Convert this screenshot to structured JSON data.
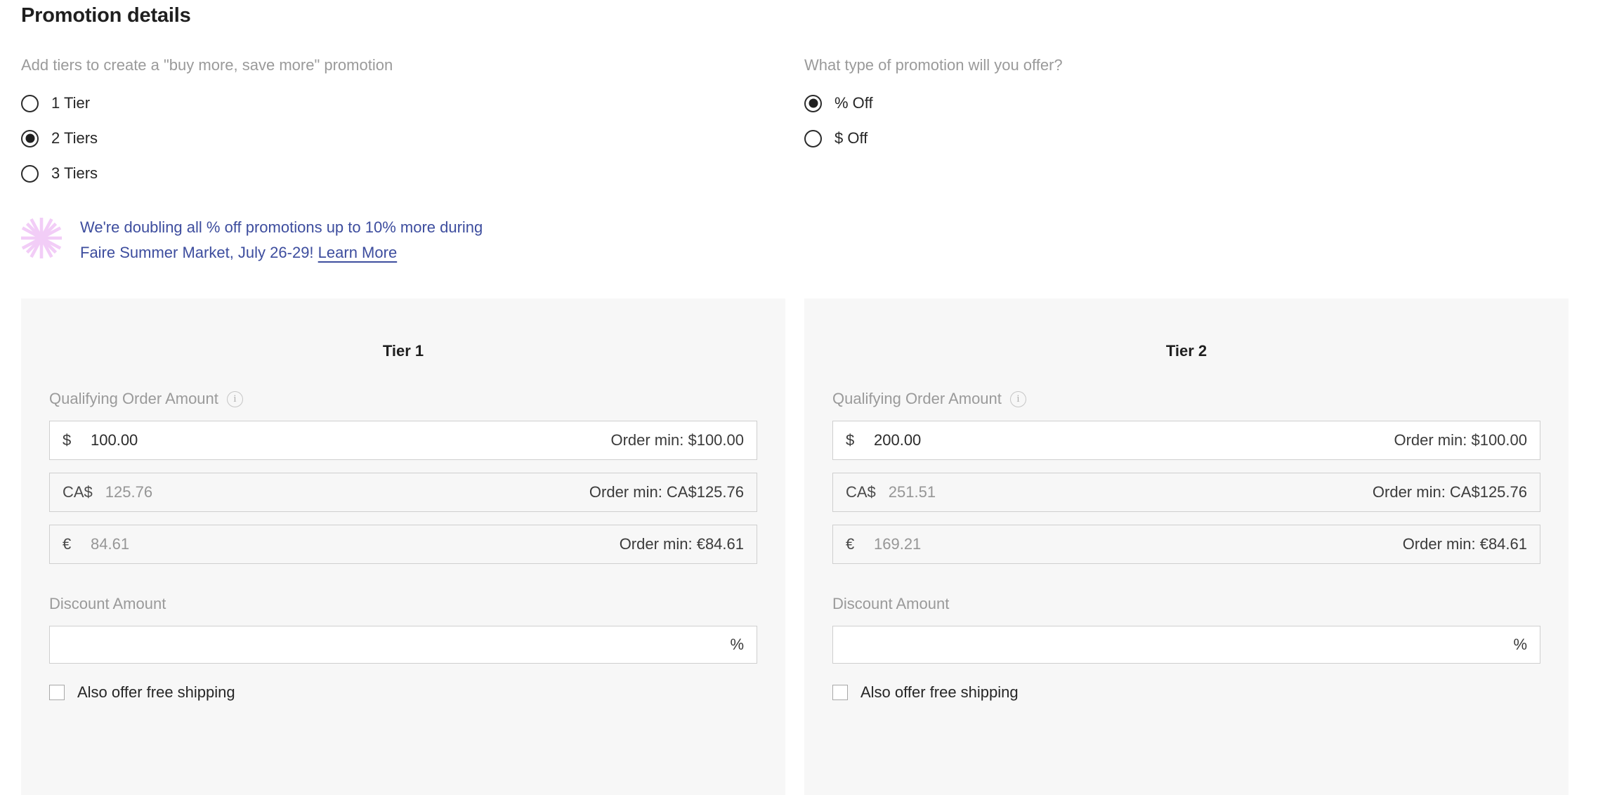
{
  "page_title": "Promotion details",
  "tier_count_group": {
    "prompt": "Add tiers to create a \"buy more, save more\" promotion",
    "selected": "2 Tiers",
    "options": [
      {
        "label": "1 Tier",
        "checked": false
      },
      {
        "label": "2 Tiers",
        "checked": true
      },
      {
        "label": "3 Tiers",
        "checked": false
      }
    ]
  },
  "promo_type_group": {
    "prompt": "What type of promotion will you offer?",
    "selected": "% Off",
    "options": [
      {
        "label": "% Off",
        "checked": true
      },
      {
        "label": "$ Off",
        "checked": false
      }
    ]
  },
  "promo_banner": {
    "icon": "starburst-icon",
    "icon_color": "#f2cdf7",
    "text_color": "#3d4d9e",
    "line1": "We're doubling all % off promotions up to 10% more during",
    "line2": "Faire Summer Market, July 26-29!",
    "link_label": "Learn More"
  },
  "tiers": [
    {
      "heading": "Tier 1",
      "qualifying_label": "Qualifying Order Amount",
      "qualifying_info_icon": "info-icon",
      "amounts": [
        {
          "currency": "$",
          "value": "100.00",
          "order_min": "Order min: $100.00",
          "disabled": false
        },
        {
          "currency": "CA$",
          "value": "125.76",
          "order_min": "Order min: CA$125.76",
          "disabled": true
        },
        {
          "currency": "€",
          "value": "84.61",
          "order_min": "Order min: €84.61",
          "disabled": true
        }
      ],
      "discount_label": "Discount Amount",
      "discount_value": "",
      "discount_placeholder": "",
      "discount_suffix": "%",
      "free_shipping_label": "Also offer free shipping",
      "free_shipping_checked": false
    },
    {
      "heading": "Tier 2",
      "qualifying_label": "Qualifying Order Amount",
      "qualifying_info_icon": "info-icon",
      "amounts": [
        {
          "currency": "$",
          "value": "200.00",
          "order_min": "Order min: $100.00",
          "disabled": false
        },
        {
          "currency": "CA$",
          "value": "251.51",
          "order_min": "Order min: CA$125.76",
          "disabled": true
        },
        {
          "currency": "€",
          "value": "169.21",
          "order_min": "Order min: €84.61",
          "disabled": true
        }
      ],
      "discount_label": "Discount Amount",
      "discount_value": "",
      "discount_placeholder": "",
      "discount_suffix": "%",
      "free_shipping_label": "Also offer free shipping",
      "free_shipping_checked": false
    }
  ],
  "colors": {
    "page_bg": "#ffffff",
    "card_bg": "#f7f7f7",
    "text": "#262626",
    "muted_text": "#9a9a9a",
    "border": "#cfcfcf",
    "accent_blue": "#3d4d9e",
    "accent_pink": "#f2cdf7"
  }
}
